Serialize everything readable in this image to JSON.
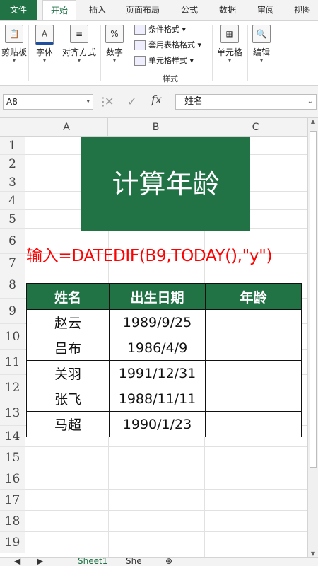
{
  "tabs": {
    "file": "文件",
    "items": [
      "开始",
      "插入",
      "页面布局",
      "公式",
      "数据",
      "审阅",
      "视图"
    ],
    "active_index": 0
  },
  "ribbon": {
    "clipboard": "剪贴板",
    "font": "字体",
    "alignment": "对齐方式",
    "number": "数字",
    "conditional_format": "条件格式",
    "table_format": "套用表格格式",
    "cell_style": "单元格样式",
    "styles_group": "样式",
    "cells": "单元格",
    "editing": "编辑"
  },
  "formula_bar": {
    "name_box": "A8",
    "content": "姓名",
    "fx": "fx"
  },
  "columns": [
    "A",
    "B",
    "C"
  ],
  "rows": [
    "1",
    "2",
    "3",
    "4",
    "5",
    "6",
    "7",
    "8",
    "9",
    "10",
    "11",
    "12",
    "13",
    "14",
    "15",
    "16",
    "17",
    "18",
    "19"
  ],
  "title": "计算年龄",
  "formula_note": "输入=DATEDIF(B9,TODAY(),\"y\")",
  "table": {
    "headers": [
      "姓名",
      "出生日期",
      "年龄"
    ],
    "rows": [
      [
        "赵云",
        "1989/9/25",
        ""
      ],
      [
        "吕布",
        "1986/4/9",
        ""
      ],
      [
        "关羽",
        "1991/12/31",
        ""
      ],
      [
        "张飞",
        "1988/11/11",
        ""
      ],
      [
        "马超",
        "1990/1/23",
        ""
      ]
    ]
  },
  "sheet_tabs": [
    "Sheet1",
    "She"
  ],
  "colors": {
    "accent": "#217346",
    "formula_text": "#ff0000"
  }
}
